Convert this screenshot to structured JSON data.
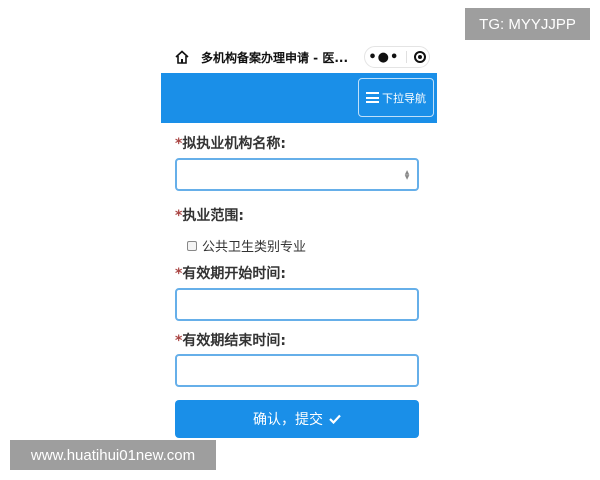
{
  "watermarks": {
    "tg": "TG: MYYJJPP",
    "url": "www.huatihui01new.com"
  },
  "topbar": {
    "title": "多机构备案办理申请 - 医...",
    "icons": [
      "home-icon",
      "more-icon",
      "target-icon"
    ],
    "more_glyph": "•●•"
  },
  "navbar": {
    "color": "#1a8fe8",
    "menu_label": "下拉导航"
  },
  "form": {
    "required_mark": "*",
    "institution": {
      "label": "拟执业机构名称:",
      "value": ""
    },
    "scope": {
      "label": "执业范围:",
      "options": [
        {
          "label": "公共卫生类别专业",
          "checked": false
        }
      ]
    },
    "start_time": {
      "label": "有效期开始时间:",
      "value": ""
    },
    "end_time": {
      "label": "有效期结束时间:",
      "value": ""
    },
    "submit_label": "确认，提交"
  }
}
